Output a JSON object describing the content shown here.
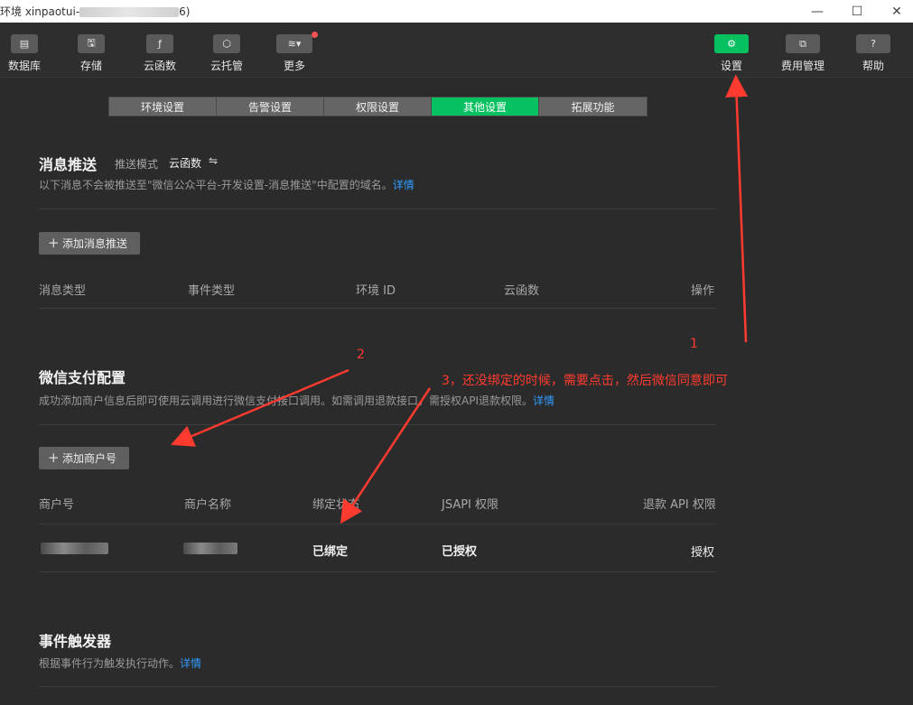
{
  "window": {
    "title_prefix": "环境 xinpaotui-",
    "title_suffix": "6)",
    "minimize": "—",
    "maximize": "☐",
    "close": "✕"
  },
  "toolbar": {
    "left": [
      {
        "label": "数据库",
        "icon": "database-icon",
        "glyph": "▤"
      },
      {
        "label": "存储",
        "icon": "storage-icon",
        "glyph": "🖫"
      },
      {
        "label": "云函数",
        "icon": "cloud-function-icon",
        "glyph": "ƒ"
      },
      {
        "label": "云托管",
        "icon": "cloud-hosting-icon",
        "glyph": "⬡"
      },
      {
        "label": "更多",
        "icon": "more-icon",
        "glyph": "≋▾"
      }
    ],
    "right": [
      {
        "label": "设置",
        "icon": "gear-icon",
        "glyph": "⚙"
      },
      {
        "label": "费用管理",
        "icon": "billing-icon",
        "glyph": "⧉"
      },
      {
        "label": "帮助",
        "icon": "help-icon",
        "glyph": "?"
      }
    ]
  },
  "tabs": [
    "环境设置",
    "告警设置",
    "权限设置",
    "其他设置",
    "拓展功能"
  ],
  "message_push": {
    "title": "消息推送",
    "mode_label": "推送模式",
    "mode_value": "云函数",
    "swap_glyph": "⇋",
    "desc": "以下消息不会被推送至\"微信公众平台-开发设置-消息推送\"中配置的域名。",
    "detail_link": "详情",
    "add_button": "添加消息推送",
    "columns": [
      "消息类型",
      "事件类型",
      "环境 ID",
      "云函数",
      "操作"
    ]
  },
  "wechat_pay": {
    "title": "微信支付配置",
    "desc": "成功添加商户信息后即可使用云调用进行微信支付接口调用。如需调用退款接口，需授权API退款权限。",
    "detail_link": "详情",
    "add_button": "添加商户号",
    "columns": [
      "商户号",
      "商户名称",
      "绑定状态",
      "JSAPI 权限",
      "退款 API 权限"
    ],
    "row": {
      "bind_status": "已绑定",
      "jsapi": "已授权",
      "refund_action": "授权"
    }
  },
  "event_trigger": {
    "title": "事件触发器",
    "desc": "根据事件行为触发执行动作。",
    "detail_link": "详情"
  },
  "annotations": {
    "a1": "1",
    "a2": "2",
    "a3": "3，还没绑定的时候，需要点击，然后微信同意即可",
    "color": "#ff3b30"
  },
  "colors": {
    "accent": "#07c160",
    "link": "#2f9bff",
    "background": "#2b2b2b"
  }
}
